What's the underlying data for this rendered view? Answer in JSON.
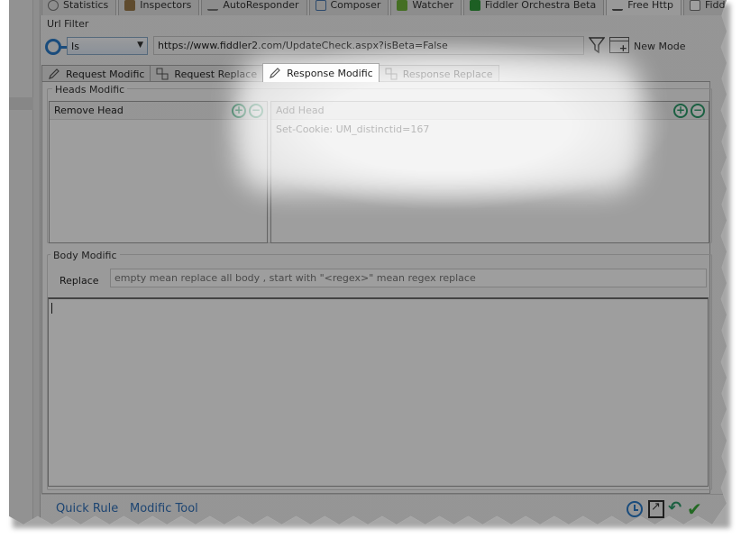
{
  "top_tabs": [
    {
      "label": "Statistics"
    },
    {
      "label": "Inspectors"
    },
    {
      "label": "AutoResponder"
    },
    {
      "label": "Composer"
    },
    {
      "label": "Watcher"
    },
    {
      "label": "Fiddler Orchestra Beta"
    },
    {
      "label": "Free Http"
    },
    {
      "label": "FiddlerScript"
    }
  ],
  "url_filter": {
    "label": "Url Filter",
    "operator": "Is",
    "url": "https://www.fiddler2.com/UpdateCheck.aspx?isBeta=False",
    "new_mode_label": "New Mode"
  },
  "sub_tabs": [
    {
      "label": "Request Modific",
      "icon": "pencil-icon"
    },
    {
      "label": "Request Replace",
      "icon": "replace-icon"
    },
    {
      "label": "Response Modific",
      "icon": "pencil-icon",
      "active": true
    },
    {
      "label": "Response Replace",
      "icon": "replace-icon"
    }
  ],
  "heads": {
    "legend": "Heads Modific",
    "remove_title": "Remove Head",
    "add_title": "Add Head",
    "add_items": [
      "Set-Cookie: UM_distinctid=167"
    ]
  },
  "body": {
    "legend": "Body Modific",
    "replace_label": "Replace",
    "replace_placeholder": "empty mean replace all body , start with \"<regex>\" mean regex replace"
  },
  "status": {
    "quick_rule": "Quick Rule",
    "modific_tool": "Modific Tool"
  },
  "colors": {
    "accent_green": "#2e9b6c",
    "link_blue": "#2f6fb8",
    "icon_blue": "#2b7bc9"
  }
}
